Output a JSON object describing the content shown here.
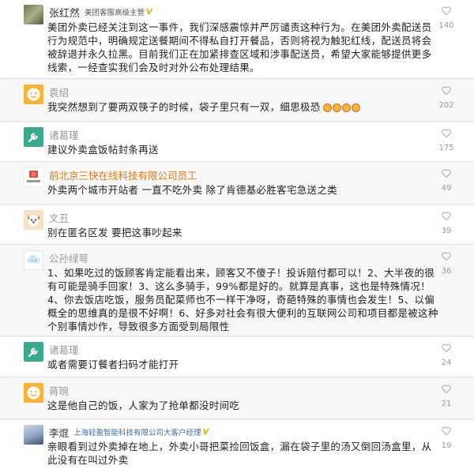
{
  "comments": [
    {
      "name": "张红然",
      "title": "美团客服高级主管",
      "badge": "V",
      "text": "美团外卖已经关注到这一事件，我们深感震惊并严厉谴责这种行为。在美团外卖配送员行为规范中，明确规定送餐期间不得私自打开餐品，否则将视为触犯红线，配送员将会被辞退并永久拉黑。目前我们正在加紧排查区域和涉事配送员，希望大家能够提供更多线索，一经查实我们会及时对外公布处理结果。",
      "likes": "140",
      "avatar": "photo"
    },
    {
      "name": "袁绍",
      "text": "我突然想到了要两双筷子的时候，袋子里只有一双，细思极恐",
      "likes": "202",
      "avatar": "smile-icon"
    },
    {
      "name": "诸葛瑾",
      "text": "建议外卖盒饭帖封条再送",
      "likes": "175",
      "avatar": "wrench-icon"
    },
    {
      "name": "前北京三快在线科技有限公司员工",
      "text": "外卖两个城市开站者 一直不吃外卖 除了肯德基必胜客宅急送之类",
      "likes": "49",
      "avatar": "meituan-logo"
    },
    {
      "name": "文丑",
      "text": "别在匿名区发 要把这事吵起来",
      "likes": "39",
      "avatar": "dog-icon"
    },
    {
      "name": "公孙绿萼",
      "text": "1、如果吃过的饭顾客肯定能看出来，顾客又不傻子！投诉赔付都可以！2、大半夜的很有可能是骑手回家！3、这么多骑手，99%都是好的。就算是真事，这也是特殊情况！4、你去饭店吃饭，服务员配菜师也不一样干净呀，奇葩特殊的事情也会发生！5、以偏概全的思维真的是很不好啊！6、好多对社会有很大便利的互联网公司和项目都是被这种个别事情炒作，导致很多方面受到局限性",
      "likes": "36",
      "avatar": "cloud-icon"
    },
    {
      "name": "诸葛瑾",
      "text": "或者需要订餐者扫码才能打开",
      "likes": "24",
      "avatar": "wrench-icon"
    },
    {
      "name": "蒋琬",
      "text": "这是他自己的饭，人家为了抢单都没时间吃",
      "likes": "21",
      "avatar": "smile-icon"
    },
    {
      "name": "李焜",
      "title": "上海轻盈智能科技有限公司大客户经理",
      "badge": "V",
      "text": "亲眼看到过外卖掉在地上，外卖小哥把菜捡回饭盒，漏在袋子里的汤又倒回汤盒里，从此没有在叫过外卖",
      "likes": "19",
      "avatar": "photo"
    }
  ],
  "colors": {
    "orange_name": "#e07a21",
    "badge": "#f2a900",
    "teal_avatar": "#3aa98f"
  }
}
